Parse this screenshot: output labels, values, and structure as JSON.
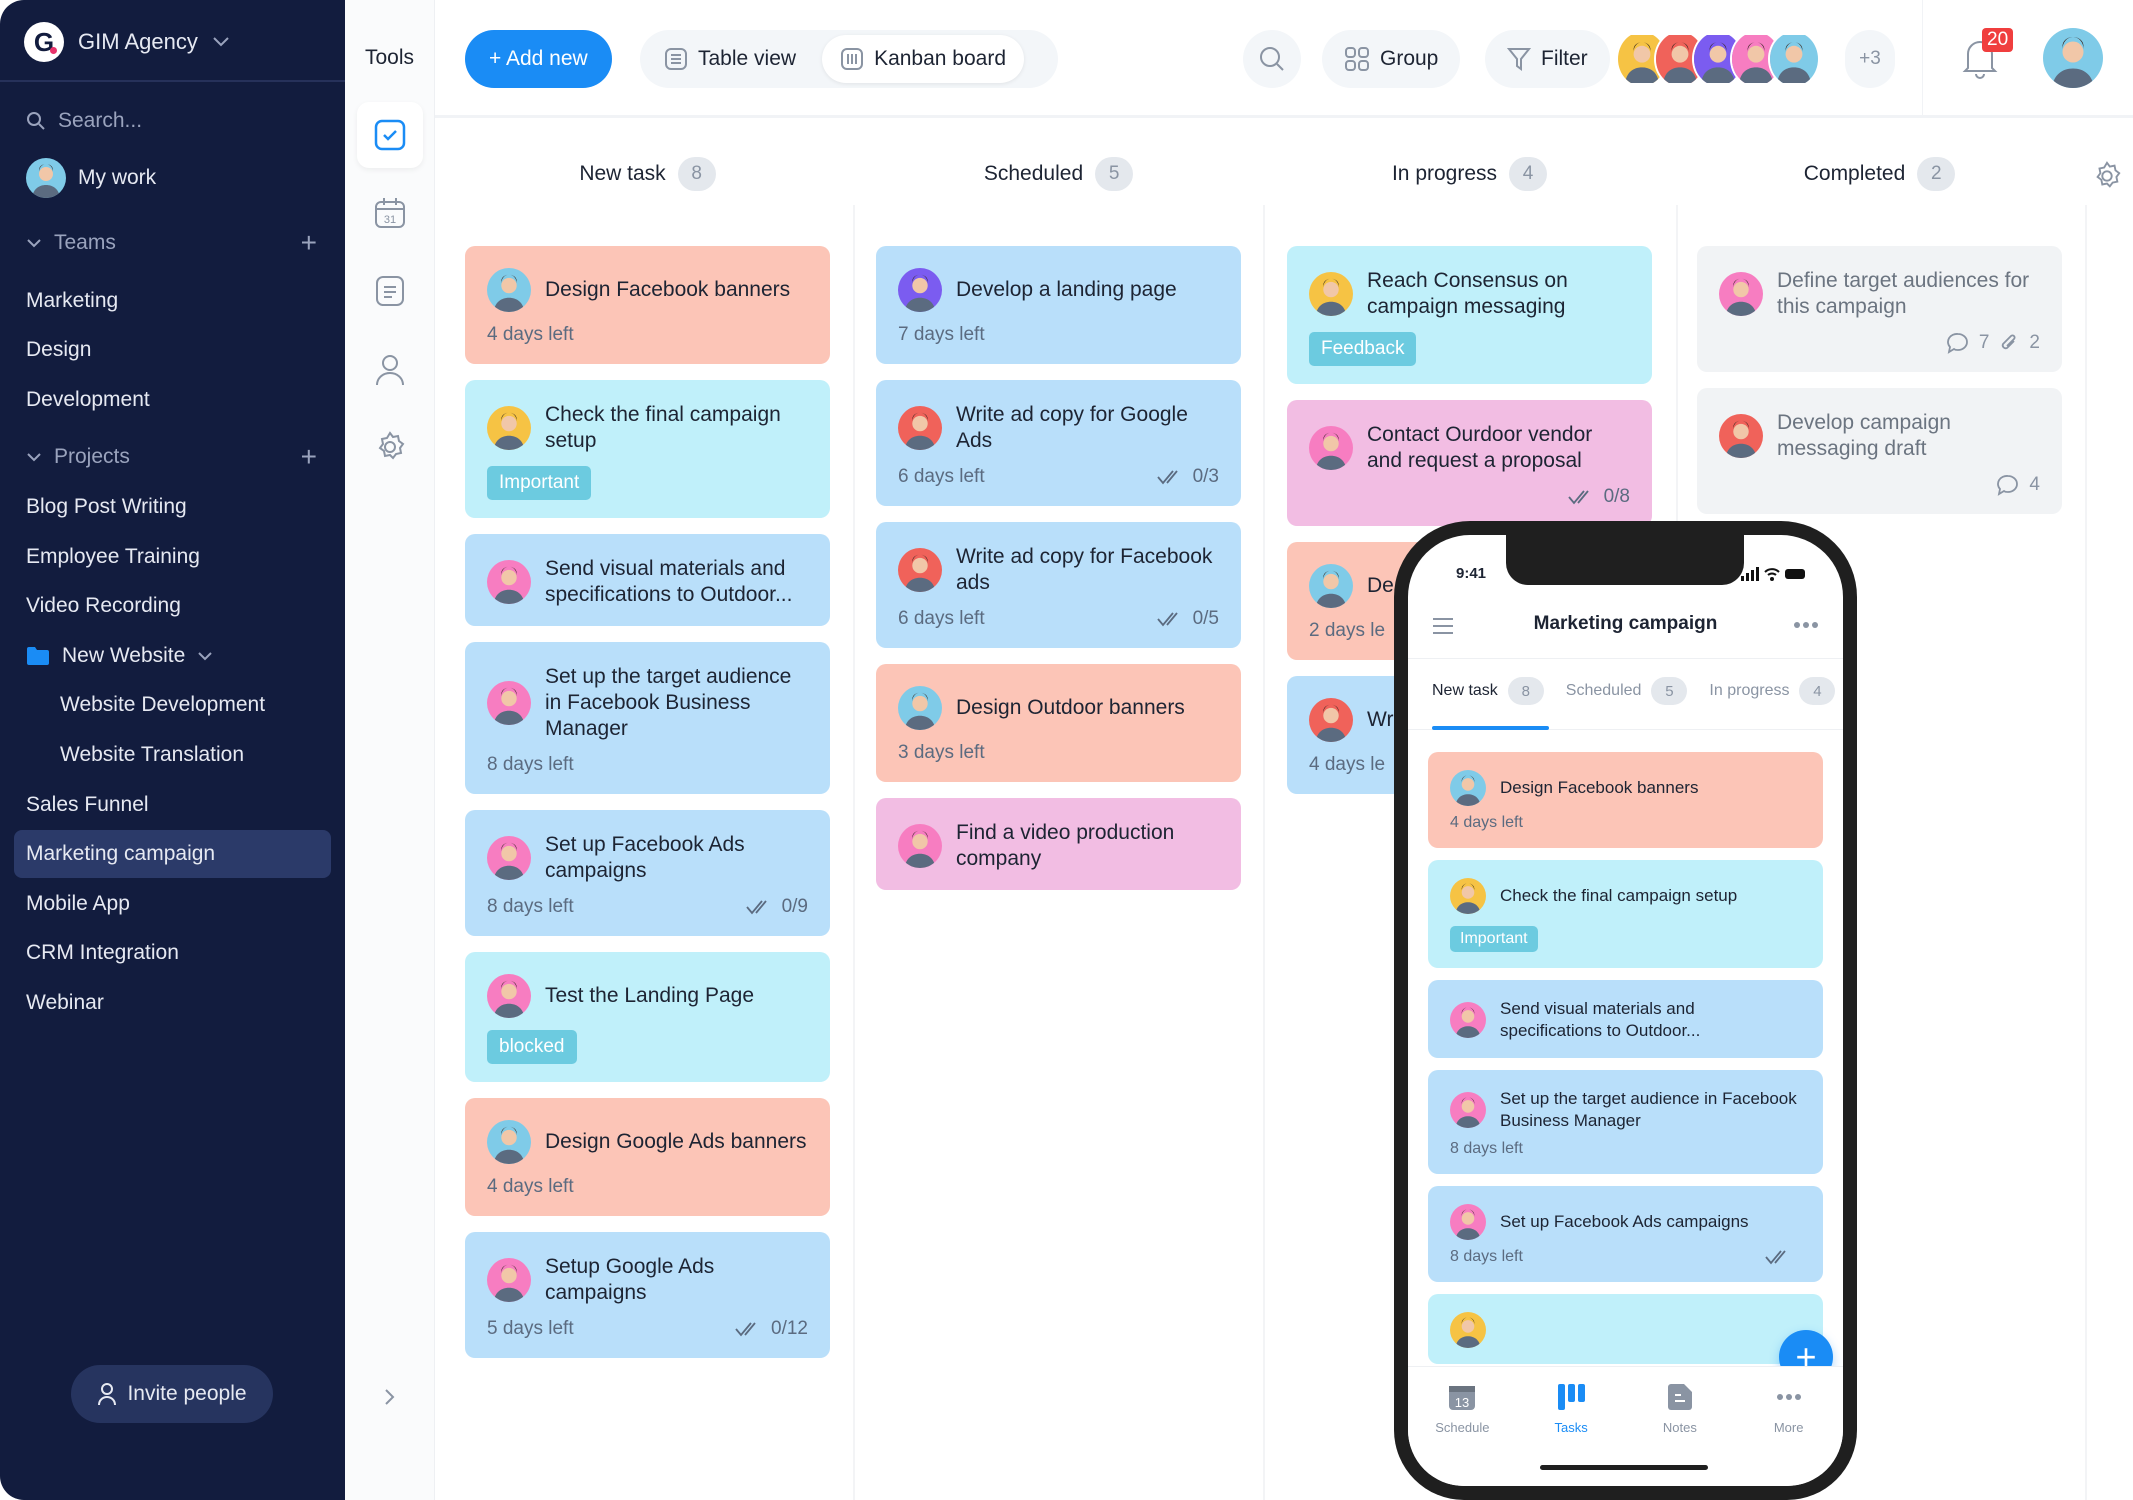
{
  "colors": {
    "accent": "#1a8cf5",
    "sidebar": "#121c3e",
    "salmon": "#fcc5b7",
    "cyan": "#c0f0fa",
    "blue": "#b9dffa",
    "pink": "#f2bde3",
    "gray": "#f1f3f5",
    "tag": "#6ccbe0",
    "badge": "#f03e3e"
  },
  "avatars": {
    "man": "#7fcbe8",
    "yellow": "#f6c344",
    "red": "#f0625a",
    "pink": "#f77dc1",
    "purple": "#7b5cf0"
  },
  "sidebar": {
    "workspace": "GIM Agency",
    "logo_letter": "G",
    "search_placeholder": "Search...",
    "my_work": "My work",
    "teams_label": "Teams",
    "teams": [
      "Marketing",
      "Design",
      "Development"
    ],
    "projects_label": "Projects",
    "projects": [
      "Blog Post Writing",
      "Employee Training",
      "Video Recording"
    ],
    "folder": "New Website",
    "folder_items": [
      "Website Development",
      "Website Translation"
    ],
    "projects_after": [
      "Sales Funnel",
      "Marketing campaign",
      "Mobile App",
      "CRM Integration",
      "Webinar"
    ],
    "selected": "Marketing campaign",
    "invite": "Invite people"
  },
  "tools": {
    "title": "Tools",
    "items": [
      "tasks-icon",
      "calendar-icon",
      "notes-icon",
      "user-icon",
      "gear-icon"
    ],
    "calendar_day": "31"
  },
  "header": {
    "add_new": "+ Add new",
    "table_view": "Table view",
    "kanban_board": "Kanban board",
    "group": "Group",
    "filter": "Filter",
    "members_more": "+3",
    "notifications": "20",
    "members": [
      "yellow",
      "red",
      "purple",
      "pink",
      "man"
    ]
  },
  "columns": [
    {
      "name": "New task",
      "count": "8",
      "cards": [
        {
          "title": "Design Facebook banners",
          "days": "4 days left",
          "color": "salmon",
          "avatar": "man"
        },
        {
          "title": "Check the final campaign setup",
          "tag": "Important",
          "color": "cyan",
          "avatar": "yellow"
        },
        {
          "title": "Send visual materials and specifications to Outdoor...",
          "color": "blue",
          "avatar": "pink"
        },
        {
          "title": "Set up the target audience in Facebook Business Manager",
          "days": "8 days left",
          "color": "blue",
          "avatar": "pink"
        },
        {
          "title": "Set up Facebook Ads campaigns",
          "days": "8 days left",
          "checklist": "0/9",
          "color": "blue",
          "avatar": "pink"
        },
        {
          "title": "Test the Landing Page",
          "tag": "blocked",
          "color": "cyan",
          "avatar": "pink"
        },
        {
          "title": "Design Google Ads banners",
          "days": "4 days left",
          "color": "salmon",
          "avatar": "man"
        },
        {
          "title": "Setup Google Ads campaigns",
          "days": "5 days left",
          "checklist": "0/12",
          "color": "blue",
          "avatar": "pink"
        }
      ]
    },
    {
      "name": "Scheduled",
      "count": "5",
      "cards": [
        {
          "title": "Develop a landing page",
          "days": "7 days left",
          "color": "blue",
          "avatar": "purple"
        },
        {
          "title": "Write ad copy for Google Ads",
          "days": "6 days left",
          "checklist": "0/3",
          "color": "blue",
          "avatar": "red"
        },
        {
          "title": "Write ad copy for Facebook ads",
          "days": "6 days left",
          "checklist": "0/5",
          "color": "blue",
          "avatar": "red"
        },
        {
          "title": "Design Outdoor banners",
          "days": "3 days left",
          "color": "salmon",
          "avatar": "man"
        },
        {
          "title": "Find a video production company",
          "color": "pink",
          "avatar": "pink"
        }
      ]
    },
    {
      "name": "In progress",
      "count": "4",
      "cards": [
        {
          "title": "Reach Consensus on campaign messaging",
          "tag": "Feedback",
          "color": "cyan",
          "avatar": "yellow"
        },
        {
          "title": "Contact Ourdoor vendor and request a proposal",
          "checklist": "0/8",
          "color": "pink",
          "avatar": "pink"
        },
        {
          "title": "De (ge",
          "days": "2 days le",
          "color": "salmon",
          "avatar": "man"
        },
        {
          "title": "Wr",
          "days": "4 days le",
          "color": "blue",
          "avatar": "red"
        }
      ]
    },
    {
      "name": "Completed",
      "count": "2",
      "cards": [
        {
          "title": "Define target audiences for this campaign",
          "comments": "7",
          "attachments": "2",
          "color": "gray",
          "avatar": "pink",
          "done": true
        },
        {
          "title": "Develop campaign messaging draft",
          "comments": "4",
          "color": "gray",
          "avatar": "red",
          "done": true
        }
      ]
    }
  ],
  "phone": {
    "time": "9:41",
    "title": "Marketing campaign",
    "tabs": [
      {
        "name": "New task",
        "count": "8"
      },
      {
        "name": "Scheduled",
        "count": "5"
      },
      {
        "name": "In progress",
        "count": "4"
      }
    ],
    "cards": [
      {
        "title": "Design Facebook banners",
        "days": "4 days left",
        "color": "salmon",
        "avatar": "man"
      },
      {
        "title": "Check the final campaign setup",
        "tag": "Important",
        "color": "cyan",
        "avatar": "yellow"
      },
      {
        "title": "Send visual materials and specifications to Outdoor...",
        "color": "blue",
        "avatar": "pink"
      },
      {
        "title": "Set up the target audience in Facebook Business Manager",
        "days": "8 days left",
        "color": "blue",
        "avatar": "pink"
      },
      {
        "title": "Set up Facebook Ads campaigns",
        "days": "8 days left",
        "checklist": " ",
        "color": "blue",
        "avatar": "pink"
      },
      {
        "title": " ",
        "color": "cyan",
        "avatar": "yellow"
      }
    ],
    "nav": [
      {
        "label": "Schedule",
        "icon": "calendar-icon",
        "day": "13"
      },
      {
        "label": "Tasks",
        "icon": "kanban-icon",
        "active": true
      },
      {
        "label": "Notes",
        "icon": "notes-icon"
      },
      {
        "label": "More",
        "icon": "more-icon"
      }
    ]
  }
}
